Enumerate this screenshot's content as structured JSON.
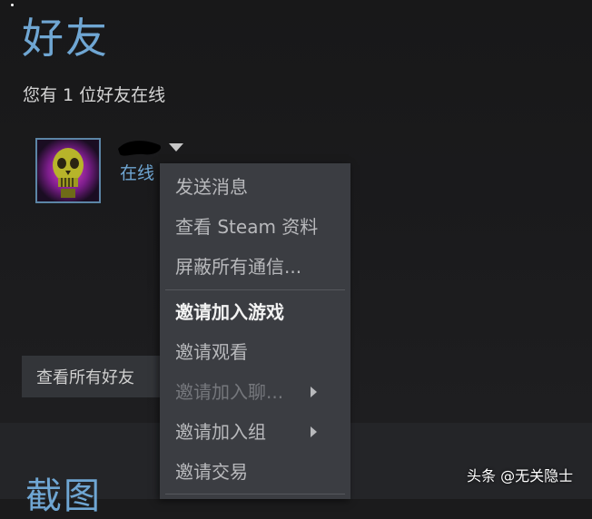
{
  "friends": {
    "title": "好友",
    "online_count": "您有 1 位好友在线",
    "view_all_label": "查看所有好友"
  },
  "friend": {
    "status": "在线"
  },
  "context_menu": {
    "items": [
      {
        "label": "发送消息",
        "state": "normal"
      },
      {
        "label": "查看 Steam 资料",
        "state": "normal"
      },
      {
        "label": "屏蔽所有通信...",
        "state": "normal"
      },
      {
        "label": "邀请加入游戏",
        "state": "highlighted"
      },
      {
        "label": "邀请观看",
        "state": "normal"
      },
      {
        "label": "邀请加入聊...",
        "state": "disabled",
        "submenu": true
      },
      {
        "label": "邀请加入组",
        "state": "normal",
        "submenu": true
      },
      {
        "label": "邀请交易",
        "state": "normal"
      }
    ]
  },
  "screenshots": {
    "title": "截图"
  },
  "watermark": "头条 @无关隐士",
  "colors": {
    "accent_blue": "#6fa6d3",
    "menu_bg": "#3b3d42",
    "page_bg": "#1b1b1c"
  }
}
